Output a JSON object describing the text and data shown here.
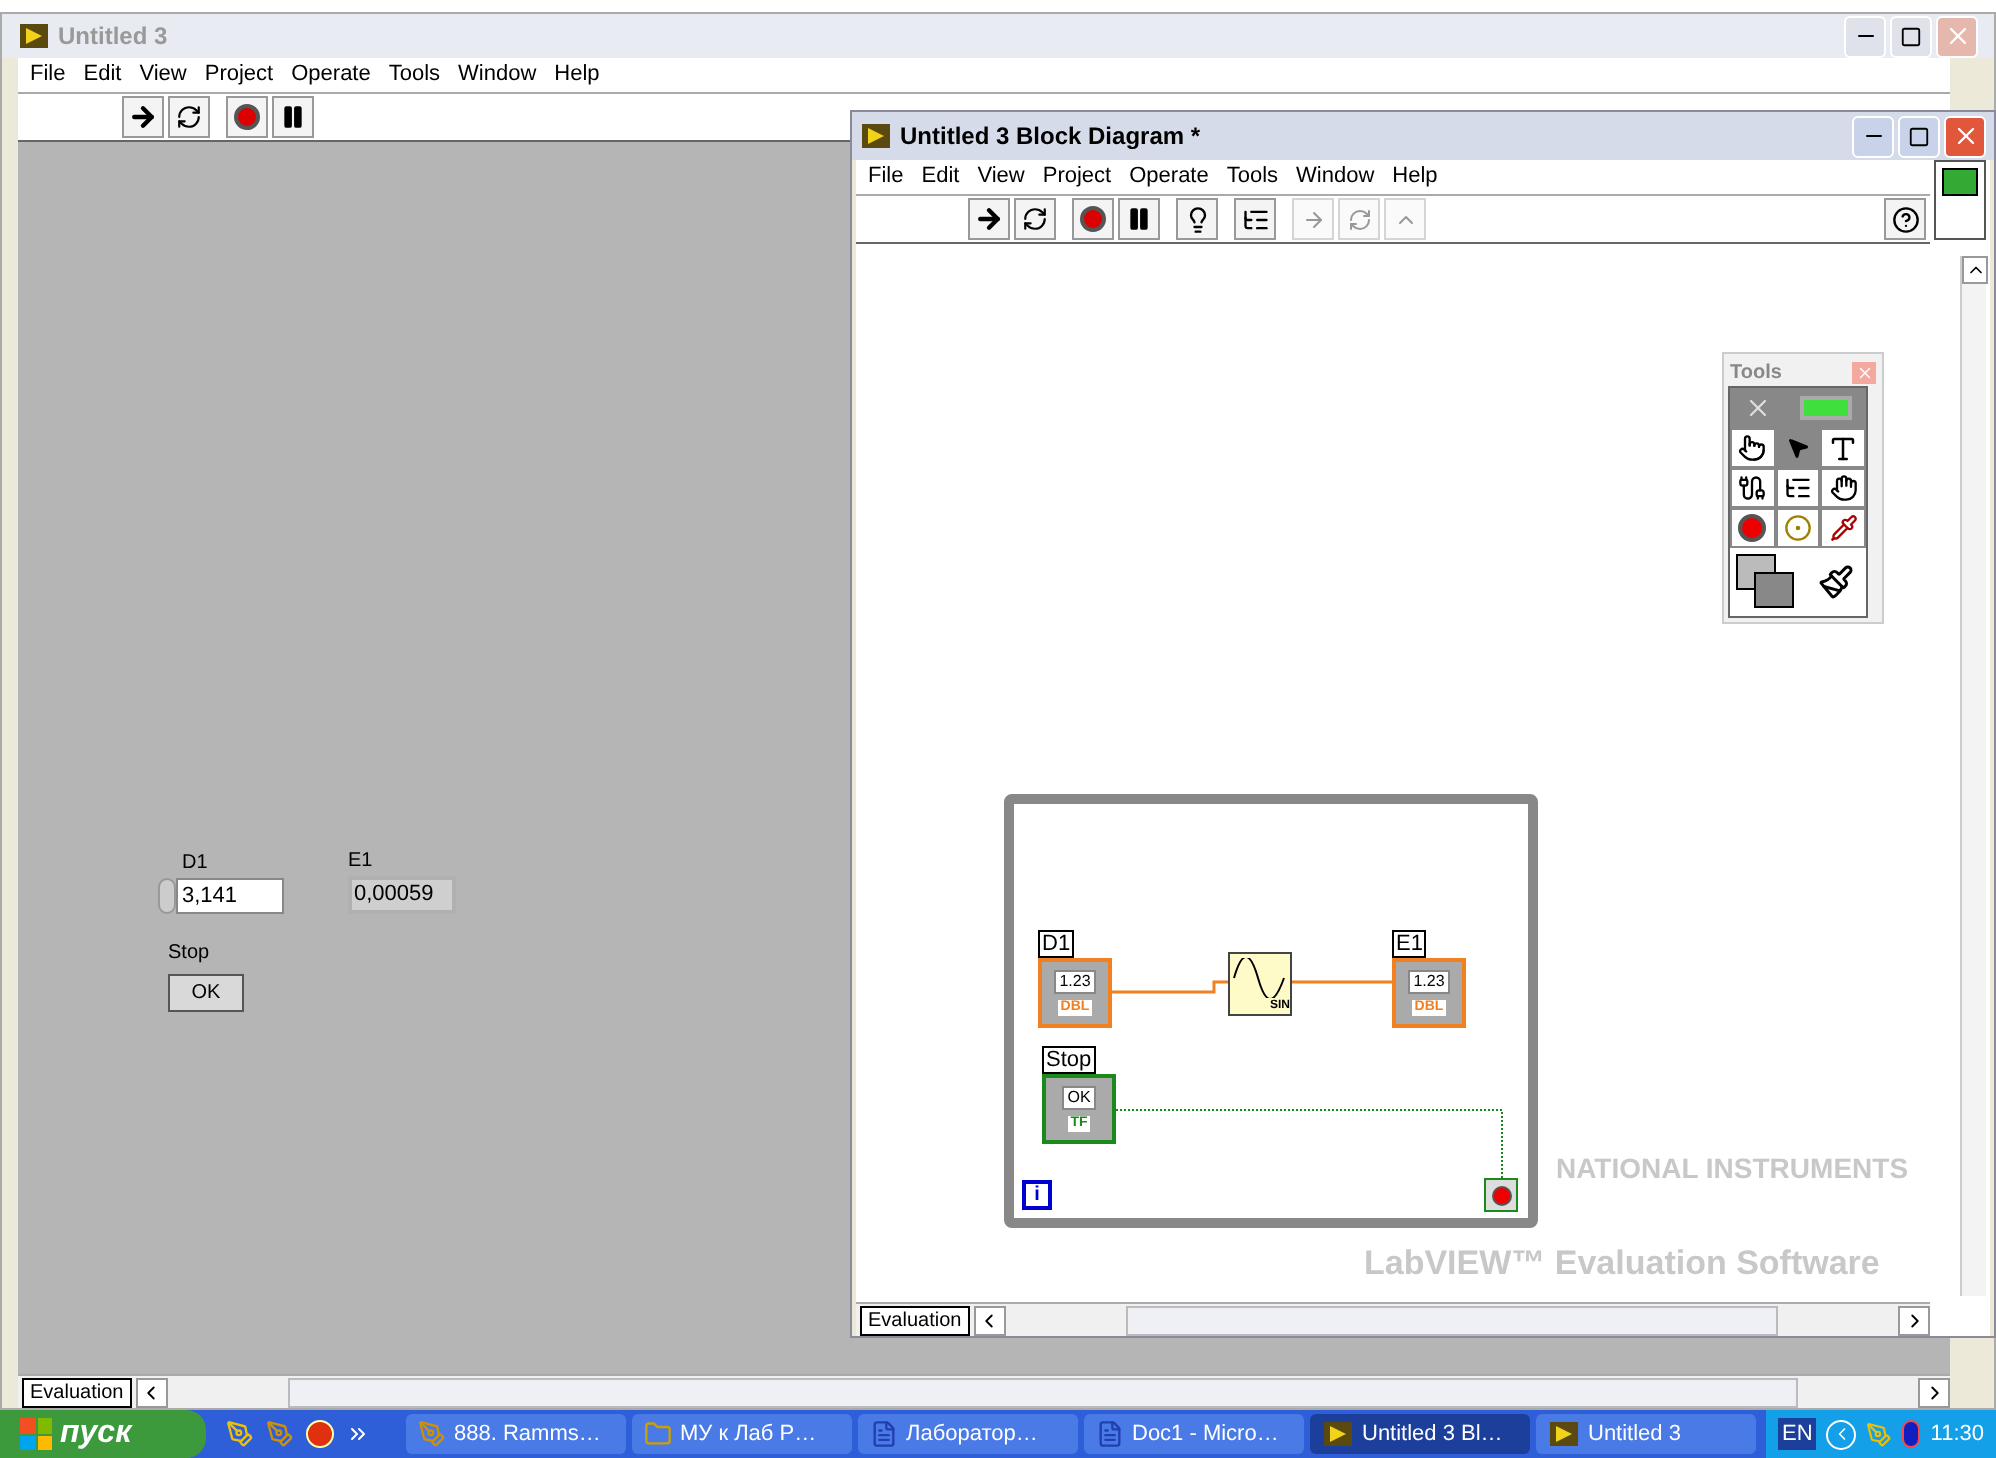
{
  "front_panel": {
    "title": "Untitled 3",
    "menu": [
      "File",
      "Edit",
      "View",
      "Project",
      "Operate",
      "Tools",
      "Window",
      "Help"
    ],
    "controls": [
      {
        "kind": "numeric_control",
        "label": "D1",
        "value": "3,141"
      },
      {
        "kind": "numeric_indicator",
        "label": "E1",
        "value": "0,00059"
      },
      {
        "kind": "boolean_button",
        "label": "Stop",
        "value": "OK"
      }
    ],
    "status_label": "Evaluation"
  },
  "block_diagram": {
    "title": "Untitled 3 Block Diagram *",
    "menu": [
      "File",
      "Edit",
      "View",
      "Project",
      "Operate",
      "Tools",
      "Window",
      "Help"
    ],
    "tools_palette": {
      "title": "Tools",
      "tools": [
        {
          "kind": "operate",
          "selected": false
        },
        {
          "kind": "position",
          "selected": true
        },
        {
          "kind": "text",
          "selected": false
        },
        {
          "kind": "wire",
          "selected": false
        },
        {
          "kind": "shortcut",
          "selected": false
        },
        {
          "kind": "scroll",
          "selected": false
        },
        {
          "kind": "breakpoint",
          "selected": false
        },
        {
          "kind": "probe",
          "selected": false
        },
        {
          "kind": "color_copy",
          "selected": false
        }
      ]
    },
    "nodes": [
      {
        "kind": "numeric_control",
        "label": "D1",
        "value": "1.23",
        "type": "DBL"
      },
      {
        "kind": "function",
        "value": "SIN"
      },
      {
        "kind": "numeric_indicator",
        "label": "E1",
        "value": "1.23",
        "type": "DBL"
      },
      {
        "kind": "boolean_control",
        "label": "Stop",
        "value": "OK",
        "type": "TF"
      }
    ],
    "loop_counter": "i",
    "status_label": "Evaluation",
    "watermark": [
      "NATIONAL INSTRUMENTS",
      "LabVIEW™ Evaluation Software"
    ]
  },
  "taskbar": {
    "start": "пуск",
    "tasks": [
      {
        "kind": "app",
        "label": "888. Ramms…",
        "selected": false
      },
      {
        "kind": "folder",
        "label": "МУ к Лаб Р…",
        "selected": false
      },
      {
        "kind": "document",
        "label": "Лаборатор…",
        "selected": false
      },
      {
        "kind": "document",
        "label": "Doc1 - Micro…",
        "selected": false
      },
      {
        "kind": "labview",
        "label": "Untitled 3 Bl…",
        "selected": true
      },
      {
        "kind": "labview",
        "label": "Untitled 3",
        "selected": false
      }
    ],
    "language": "EN",
    "clock": "11:30"
  }
}
